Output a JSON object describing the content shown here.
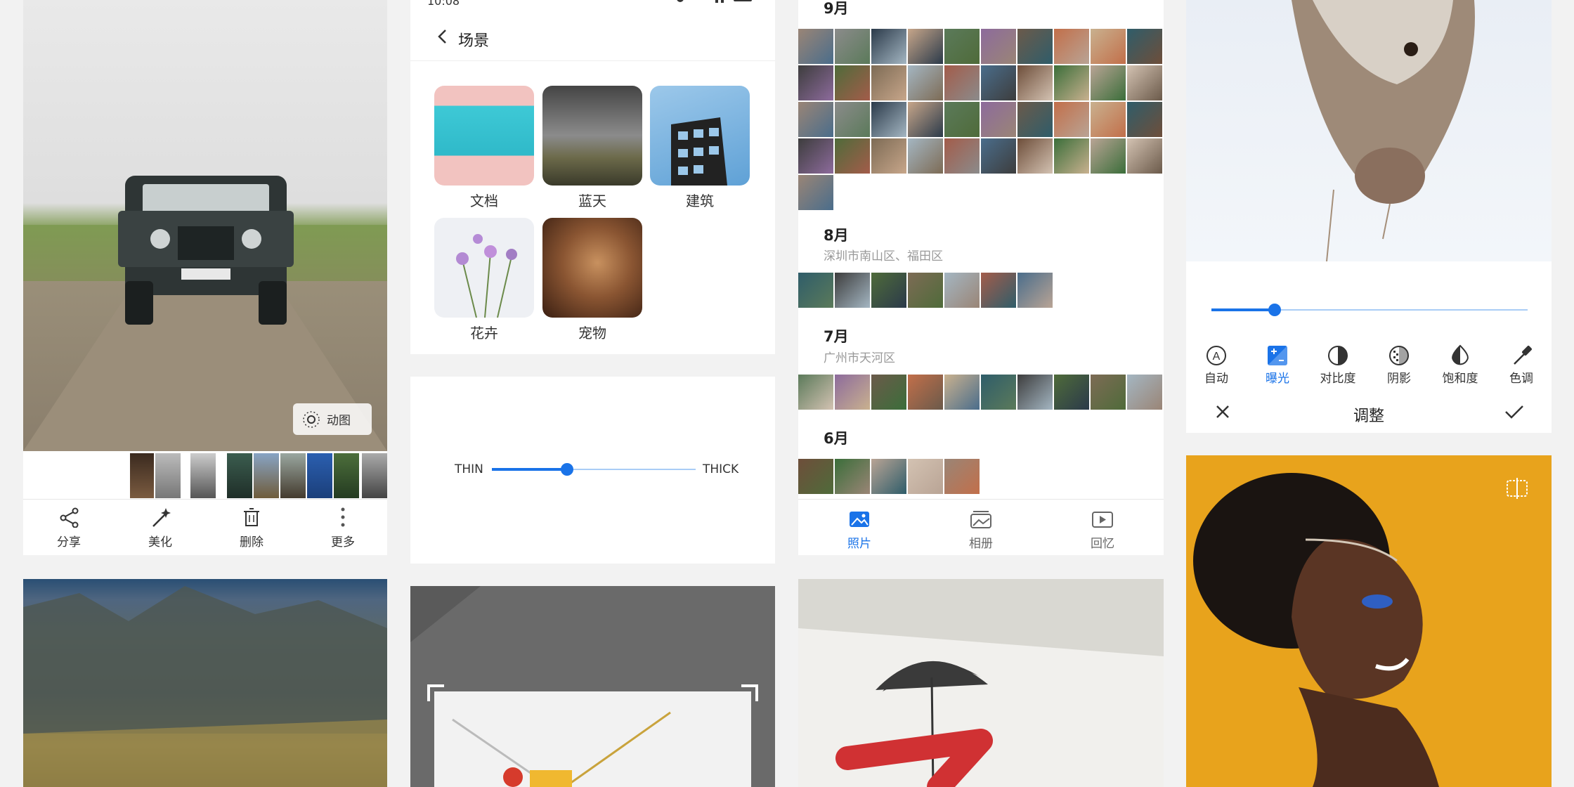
{
  "viewer": {
    "motion_badge": "动图",
    "actions": [
      {
        "label": "分享",
        "icon": "share-icon"
      },
      {
        "label": "美化",
        "icon": "magic-wand-icon"
      },
      {
        "label": "删除",
        "icon": "trash-icon"
      },
      {
        "label": "更多",
        "icon": "more-vertical-icon"
      }
    ]
  },
  "scenes": {
    "status_time": "10:08",
    "title": "场景",
    "items": [
      "文档",
      "蓝天",
      "建筑",
      "花卉",
      "宠物"
    ]
  },
  "thickness": {
    "thin_label": "THIN",
    "thick_label": "THICK",
    "value": 0.37
  },
  "album": {
    "months": [
      {
        "title": "9月",
        "location": ""
      },
      {
        "title": "8月",
        "location": "深圳市南山区、福田区"
      },
      {
        "title": "7月",
        "location": "广州市天河区"
      },
      {
        "title": "6月",
        "location": ""
      }
    ],
    "tabs": [
      {
        "label": "照片",
        "icon": "photo-icon",
        "active": true
      },
      {
        "label": "相册",
        "icon": "albums-icon",
        "active": false
      },
      {
        "label": "回忆",
        "icon": "memories-play-icon",
        "active": false
      }
    ]
  },
  "adjust": {
    "title": "调整",
    "slider_value": 0.2,
    "tools": [
      {
        "label": "自动",
        "icon": "auto-icon",
        "active": false
      },
      {
        "label": "曝光",
        "icon": "exposure-icon",
        "active": true
      },
      {
        "label": "对比度",
        "icon": "contrast-icon",
        "active": false
      },
      {
        "label": "阴影",
        "icon": "shadow-icon",
        "active": false
      },
      {
        "label": "饱和度",
        "icon": "saturation-icon",
        "active": false
      },
      {
        "label": "色调",
        "icon": "eyedropper-icon",
        "active": false
      }
    ]
  },
  "colors": {
    "accent": "#1a73e8",
    "portrait_bg": "#e8a31c"
  }
}
